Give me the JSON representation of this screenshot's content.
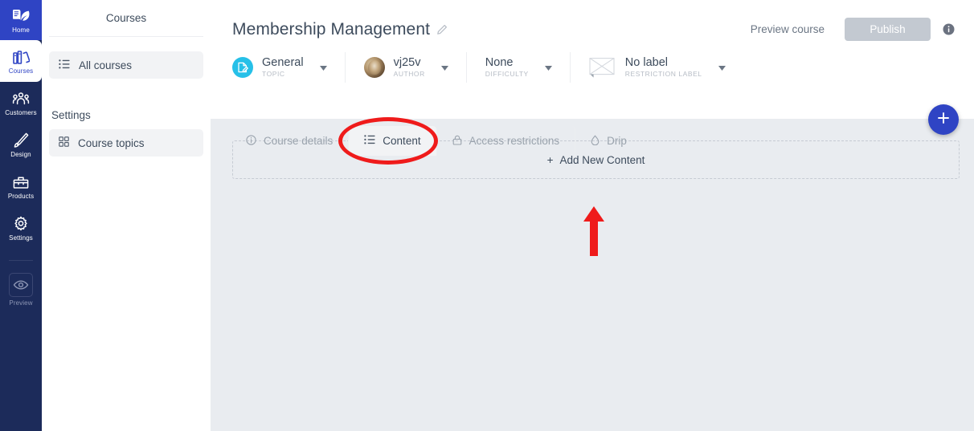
{
  "rail": {
    "items": [
      {
        "label": "Home",
        "icon": "book-open-icon",
        "state": "highlight"
      },
      {
        "label": "Courses",
        "icon": "books-icon",
        "state": "active"
      },
      {
        "label": "Customers",
        "icon": "people-icon",
        "state": "normal"
      },
      {
        "label": "Design",
        "icon": "paintbrush-icon",
        "state": "normal"
      },
      {
        "label": "Products",
        "icon": "box-icon",
        "state": "normal"
      },
      {
        "label": "Settings",
        "icon": "gear-icon",
        "state": "normal"
      }
    ],
    "preview": {
      "label": "Preview",
      "icon": "eye-icon"
    }
  },
  "sidebar": {
    "title": "Courses",
    "items": [
      {
        "label": "All courses",
        "icon": "list-icon",
        "selected": true
      }
    ],
    "group_label": "Settings",
    "settings_items": [
      {
        "label": "Course topics",
        "icon": "grid-icon",
        "selected": false
      }
    ]
  },
  "header": {
    "title": "Membership Management",
    "edit_icon": "pencil-icon",
    "preview_course": "Preview course",
    "publish_label": "Publish",
    "publish_disabled": true,
    "info_icon": "info-icon"
  },
  "meta": [
    {
      "value": "General",
      "key": "TOPIC",
      "icon": "topic-document-icon",
      "caret": "chevron-down-icon"
    },
    {
      "value": "vj25v",
      "key": "AUTHOR",
      "icon": "avatar",
      "caret": "chevron-down-icon"
    },
    {
      "value": "None",
      "key": "DIFFICULTY",
      "icon": "none",
      "caret": "chevron-down-icon"
    },
    {
      "value": "No label",
      "key": "RESTRICTION LABEL",
      "icon": "broken-image-icon",
      "caret": "chevron-down-icon"
    }
  ],
  "tabs": [
    {
      "label": "Course details",
      "icon": "info-circle-icon",
      "active": false
    },
    {
      "label": "Content",
      "icon": "list-icon",
      "active": true
    },
    {
      "label": "Access restrictions",
      "icon": "lock-icon",
      "active": false
    },
    {
      "label": "Drip",
      "icon": "droplet-icon",
      "active": false
    }
  ],
  "content": {
    "add_new_label": "Add New Content",
    "add_new_plus": "+",
    "fab_icon": "plus-icon"
  },
  "annotations": {
    "ellipse_target": "Content",
    "arrow_target": "Add New Content",
    "color": "#ef1b1b"
  },
  "colors": {
    "rail_bg": "#1c2b5a",
    "home_bg": "#2f44c4",
    "accent": "#2f44c4",
    "content_bg": "#e9ecf0",
    "topic_icon_bg": "#26c0e8",
    "publish_bg": "#c3c9d1"
  }
}
